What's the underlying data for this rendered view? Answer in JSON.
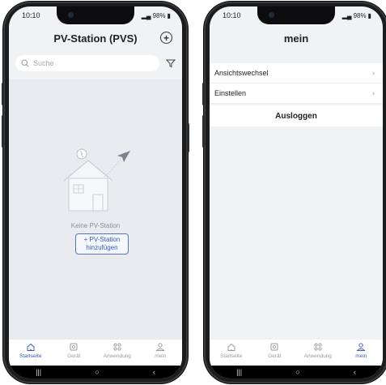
{
  "left_phone": {
    "status": {
      "time": "10:10",
      "battery": "98%"
    },
    "header": {
      "title": "PV-Station (PVS)"
    },
    "search": {
      "placeholder": "Suche"
    },
    "empty": {
      "message": "Keine PV-Station",
      "add_button": "+ PV-Station hinzufügen"
    },
    "tabs": [
      {
        "label": "Startseite",
        "icon": "home-icon",
        "active": true
      },
      {
        "label": "Gerät",
        "icon": "device-icon",
        "active": false
      },
      {
        "label": "Anwendung",
        "icon": "apps-icon",
        "active": false
      },
      {
        "label": "mein",
        "icon": "user-icon",
        "active": false
      }
    ],
    "nav": [
      "|||",
      "○",
      "‹"
    ]
  },
  "right_phone": {
    "status": {
      "time": "10:10",
      "battery": "98%"
    },
    "header": {
      "title": "mein"
    },
    "menu": [
      {
        "label": "Ansichtswechsel"
      },
      {
        "label": "Einstellen"
      }
    ],
    "logout": "Ausloggen",
    "tabs": [
      {
        "label": "Startseite",
        "icon": "home-icon",
        "active": false
      },
      {
        "label": "Gerät",
        "icon": "device-icon",
        "active": false
      },
      {
        "label": "Anwendung",
        "icon": "apps-icon",
        "active": false
      },
      {
        "label": "mein",
        "icon": "user-icon",
        "active": true
      }
    ],
    "nav": [
      "|||",
      "○",
      "‹"
    ]
  },
  "colors": {
    "accent": "#3a58b8",
    "background": "#f1f2f4",
    "empty_bg": "#e9ebee"
  }
}
